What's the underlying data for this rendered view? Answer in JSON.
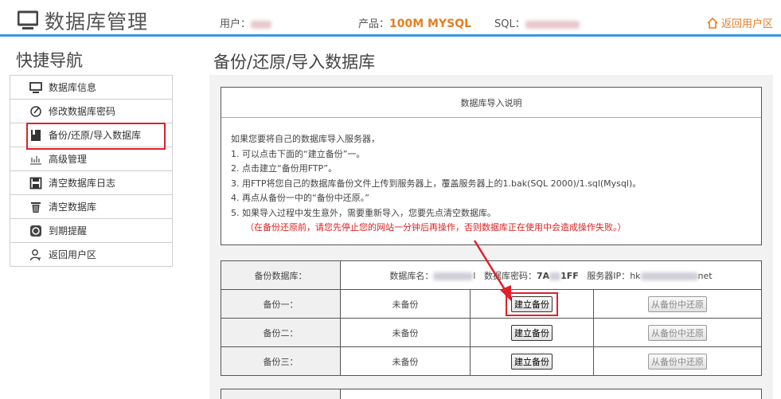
{
  "header": {
    "title": "数据库管理",
    "user_label": "用户：",
    "product_label": "产品：",
    "product_value": "100M MYSQL",
    "sql_label": "SQL：",
    "back_label": "返回用户区"
  },
  "sidebar": {
    "title": "快捷导航",
    "items": [
      {
        "label": "数据库信息",
        "icon": "monitor-icon"
      },
      {
        "label": "修改数据库密码",
        "icon": "edit-icon"
      },
      {
        "label": "备份/还原/导入数据库",
        "icon": "book-icon"
      },
      {
        "label": "高级管理",
        "icon": "chart-icon"
      },
      {
        "label": "清空数据库日志",
        "icon": "save-icon"
      },
      {
        "label": "清空数据库",
        "icon": "trash-icon"
      },
      {
        "label": "到期提醒",
        "icon": "alarm-icon"
      },
      {
        "label": "返回用户区",
        "icon": "user-icon"
      }
    ]
  },
  "main": {
    "title": "备份/还原/导入数据库",
    "notice": {
      "heading": "数据库导入说明",
      "lines": [
        "如果您要将自己的数据库导入服务器，",
        "1. 可以点击下面的“建立备份”一。",
        "2. 点击建立“备份用FTP”。",
        "3. 用FTP将您自己的数据库备份文件上传到服务器上，覆盖服务器上的1.bak(SQL 2000)/1.sql(Mysql)。",
        "4. 再点从备份一中的“备份中还原。”",
        "5. 如果导入过程中发生意外，需要重新导入，您要先点清空数据库。"
      ],
      "warning": "（在备份还原前，请您先停止您的网站一分钟后再操作，否则数据库正在使用中会造成操作失败。）"
    },
    "backup_table": {
      "db_label": "备份数据库：",
      "db_name_label": "数据库名：",
      "db_name_tail": "l",
      "db_password_label": "数据库密码：",
      "db_password_head": "7A",
      "db_password_tail": "1FF",
      "server_ip_label": "服务器IP：",
      "server_ip_head": "hk",
      "server_ip_tail": "net",
      "create_label": "建立备份",
      "restore_label": "从备份中还原",
      "rows": [
        {
          "label": "备份一：",
          "status": "未备份"
        },
        {
          "label": "备份二：",
          "status": "未备份"
        },
        {
          "label": "备份三：",
          "status": "未备份"
        }
      ]
    }
  },
  "colors": {
    "accent": "#3a9ad9",
    "highlight": "#e0202a",
    "orange": "#e67e22"
  }
}
